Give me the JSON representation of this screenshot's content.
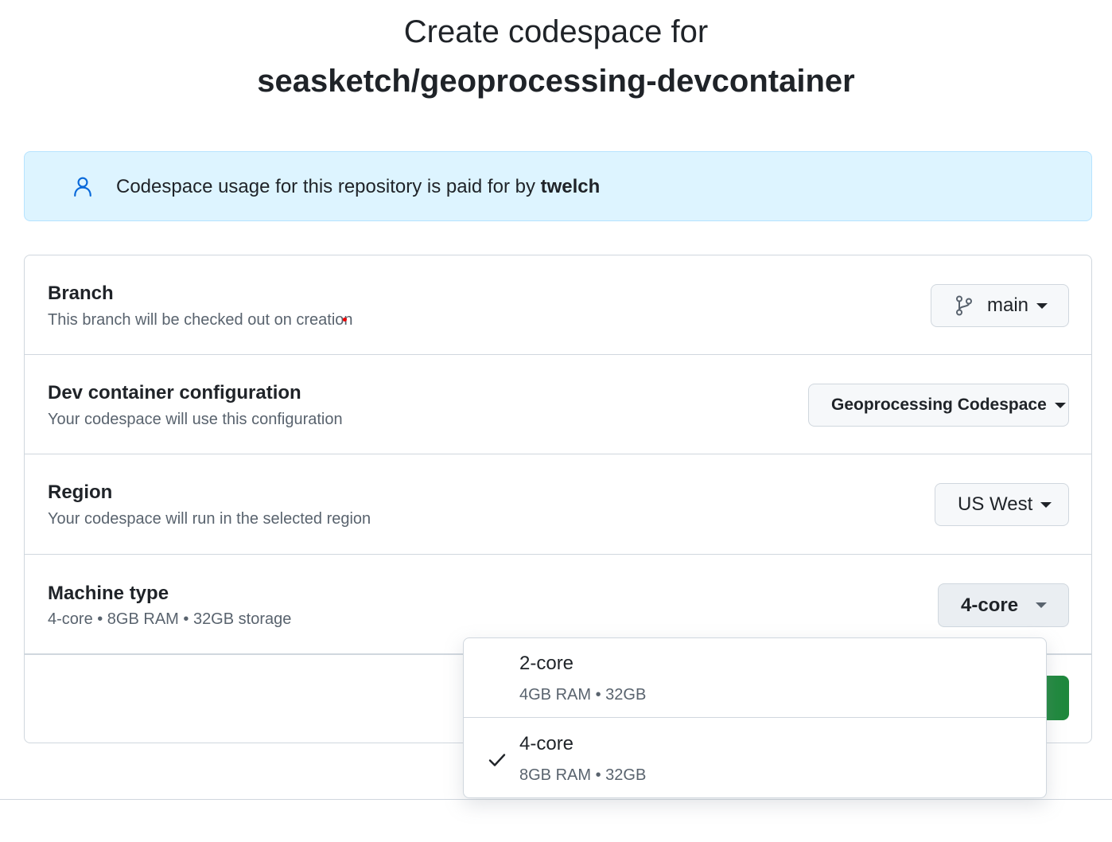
{
  "header": {
    "title_prefix": "Create codespace for",
    "repo": "seasketch/geoprocessing-devcontainer"
  },
  "banner": {
    "text": "Codespace usage for this repository is paid for by",
    "user": "twelch",
    "icon": "person-icon"
  },
  "form": {
    "branch": {
      "label": "Branch",
      "description": "This branch will be checked out on creation",
      "value": "main",
      "icon": "git-branch-icon"
    },
    "devcontainer": {
      "label": "Dev container configuration",
      "description": "Your codespace will use this configuration",
      "value": "Geoprocessing Codespace"
    },
    "region": {
      "label": "Region",
      "description": "Your codespace will run in the selected region",
      "value": "US West"
    },
    "machine": {
      "label": "Machine type",
      "description": "4-core • 8GB RAM • 32GB storage",
      "value": "4-core"
    }
  },
  "dropdown": {
    "options": [
      {
        "title": "2-core",
        "sub": "4GB RAM • 32GB",
        "selected": false
      },
      {
        "title": "4-core",
        "sub": "8GB RAM • 32GB",
        "selected": true
      }
    ]
  },
  "colors": {
    "banner_bg": "#ddf4ff",
    "accent_blue": "#0969da",
    "primary_green": "#1f883d"
  }
}
